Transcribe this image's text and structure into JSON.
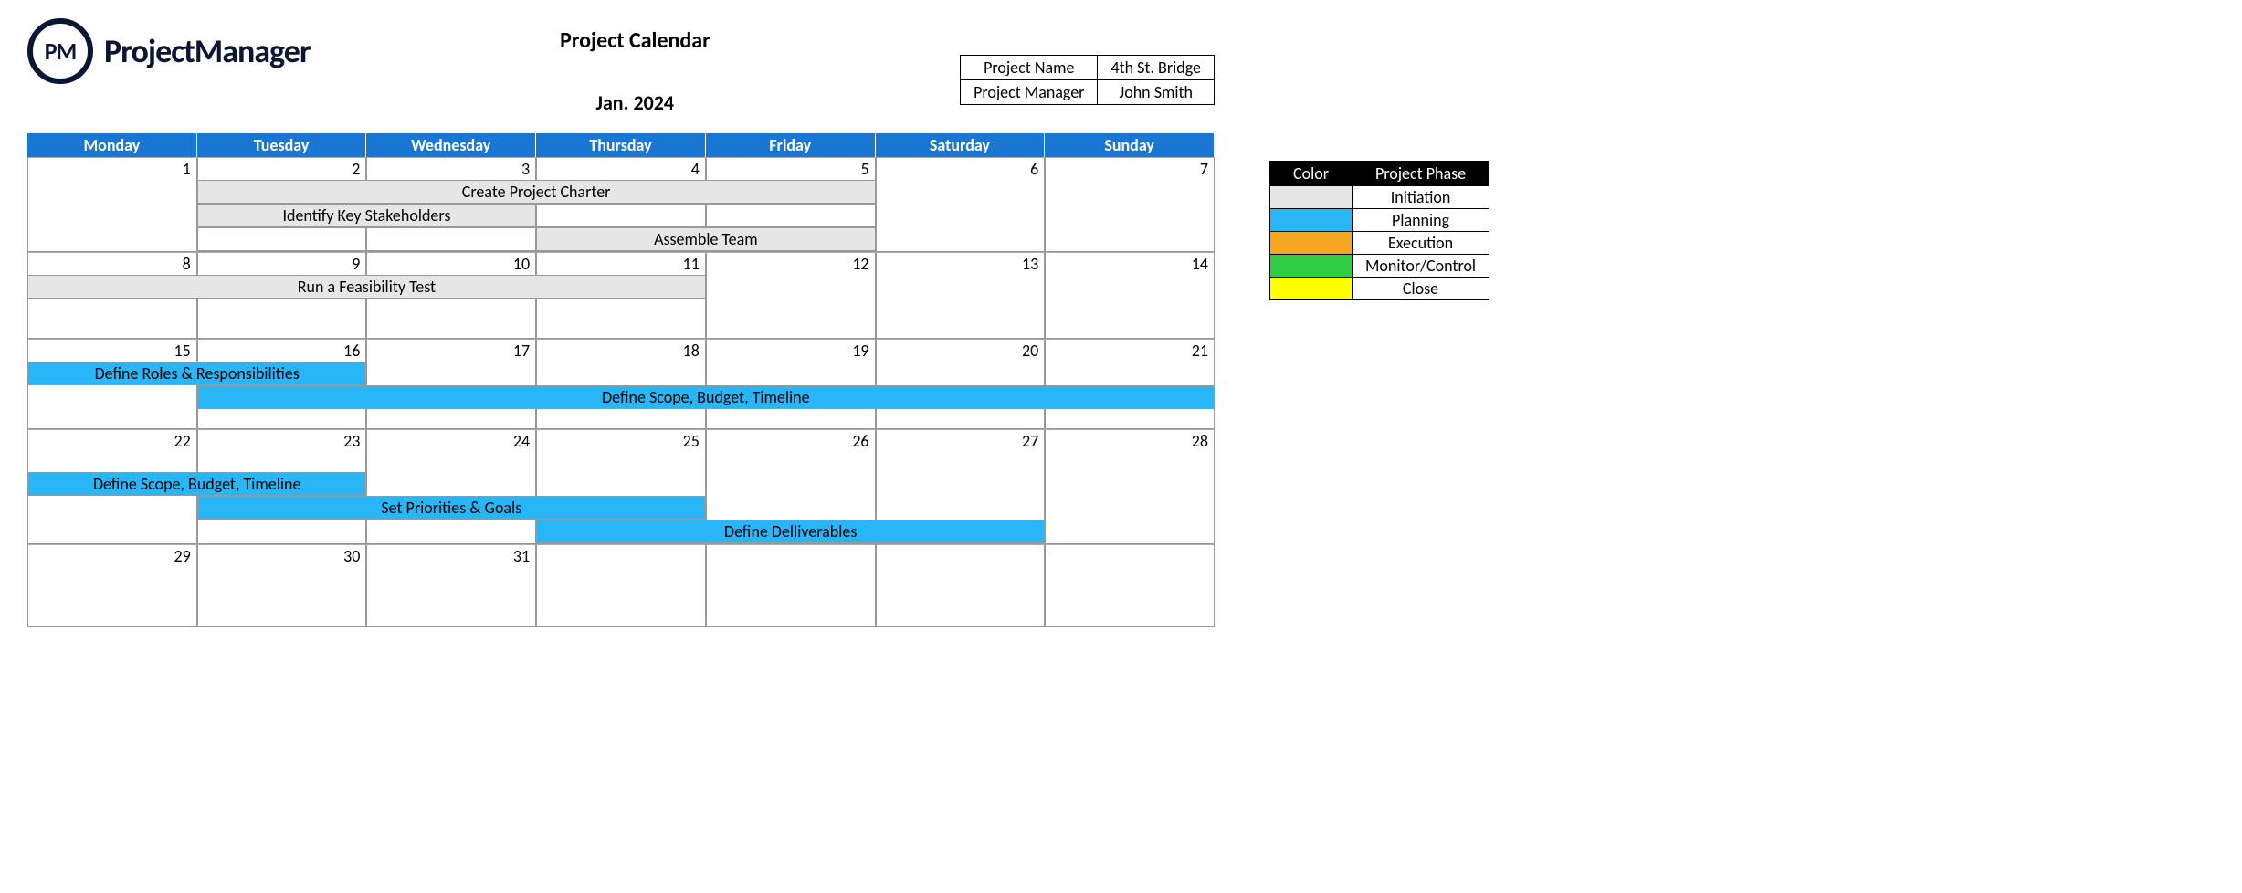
{
  "logo": {
    "mark": "PM",
    "text": "ProjectManager"
  },
  "title": "Project Calendar",
  "month": "Jan. 2024",
  "info": {
    "labels": {
      "project_name": "Project Name",
      "project_manager": "Project Manager"
    },
    "values": {
      "project_name": "4th St. Bridge",
      "project_manager": "John Smith"
    }
  },
  "days": [
    "Monday",
    "Tuesday",
    "Wednesday",
    "Thursday",
    "Friday",
    "Saturday",
    "Sunday"
  ],
  "weeks": [
    {
      "dates": [
        "1",
        "2",
        "3",
        "4",
        "5",
        "6",
        "7"
      ],
      "rows": [
        [
          null,
          {
            "text": "Create Project Charter",
            "span": 4,
            "phase": "initiation"
          },
          null,
          null
        ],
        [
          null,
          {
            "text": "Identify Key Stakeholders",
            "span": 2,
            "phase": "initiation"
          },
          {
            "text": "",
            "span": 1,
            "phase": "empty"
          },
          {
            "text": "",
            "span": 1,
            "phase": "empty"
          },
          null,
          null
        ],
        [
          null,
          {
            "text": "",
            "span": 1,
            "phase": "empty"
          },
          {
            "text": "",
            "span": 1,
            "phase": "empty"
          },
          {
            "text": "Assemble Team",
            "span": 2,
            "phase": "initiation"
          },
          null,
          null
        ]
      ]
    },
    {
      "dates": [
        "8",
        "9",
        "10",
        "11",
        "12",
        "13",
        "14"
      ],
      "rows": [
        [
          {
            "text": "Run a Feasibility Test",
            "span": 4,
            "phase": "initiation"
          },
          null,
          null,
          null
        ]
      ],
      "padRows": 2
    },
    {
      "dates": [
        "15",
        "16",
        "17",
        "18",
        "19",
        "20",
        "21"
      ],
      "rows": [
        [
          {
            "text": "Define Roles & Responsibilities",
            "span": 2,
            "phase": "planning"
          },
          null,
          null,
          null,
          null,
          null
        ],
        [
          null,
          {
            "text": "Define Scope, Budget, Timeline",
            "span": 6,
            "phase": "planning"
          }
        ]
      ],
      "padRows": 1
    },
    {
      "dates": [
        "22",
        "23",
        "24",
        "25",
        "26",
        "27",
        "28"
      ],
      "rows": [
        [
          null,
          null,
          null,
          null,
          null,
          null,
          null
        ],
        [
          {
            "text": "Define Scope, Budget, Timeline",
            "span": 2,
            "phase": "planning"
          },
          null,
          null,
          null,
          null,
          null
        ],
        [
          null,
          {
            "text": "Set Priorities & Goals",
            "span": 3,
            "phase": "planning"
          },
          null,
          null,
          null
        ],
        [
          null,
          null,
          null,
          {
            "text": "Define Delliverables",
            "span": 3,
            "phase": "planning"
          },
          null
        ]
      ]
    },
    {
      "dates": [
        "29",
        "30",
        "31",
        "",
        "",
        "",
        ""
      ],
      "rows": [],
      "padRows": 3
    }
  ],
  "legend": {
    "headers": [
      "Color",
      "Project Phase"
    ],
    "rows": [
      {
        "phase": "initiation",
        "label": "Initiation"
      },
      {
        "phase": "planning",
        "label": "Planning"
      },
      {
        "phase": "execution",
        "label": "Execution"
      },
      {
        "phase": "monitor",
        "label": "Monitor/Control"
      },
      {
        "phase": "close",
        "label": "Close"
      }
    ]
  }
}
